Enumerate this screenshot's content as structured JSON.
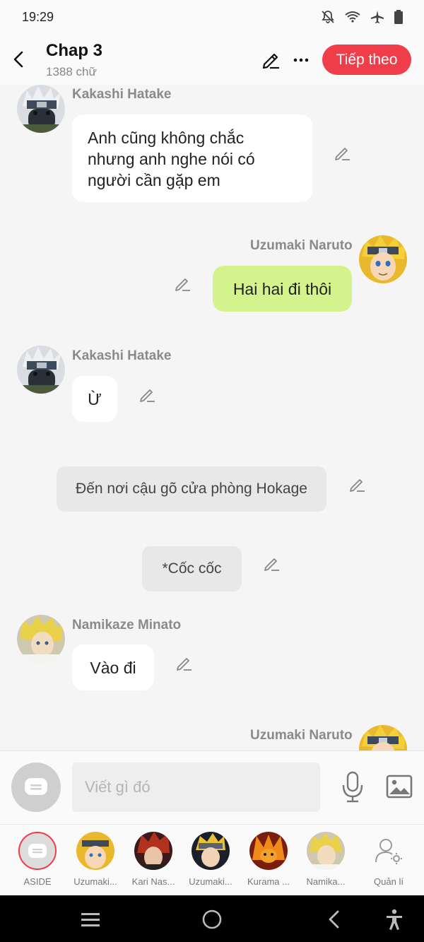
{
  "status": {
    "time": "19:29"
  },
  "header": {
    "title": "Chap 3",
    "subtitle": "1388 chữ",
    "next_label": "Tiếp theo"
  },
  "messages": [
    {
      "sender": "Kakashi Hatake",
      "text_lines": [
        "Anh cũng không chắc",
        "nhưng anh nghe nói có",
        "người cần gặp em"
      ]
    },
    {
      "sender": "Uzumaki Naruto",
      "text": "Hai hai đi thôi"
    },
    {
      "sender": "Kakashi Hatake",
      "text": "Ừ"
    },
    {
      "narration": "Đến nơi cậu gõ cửa phòng Hokage"
    },
    {
      "narration": "*Cốc cốc"
    },
    {
      "sender": "Namikaze Minato",
      "text": "Vào đi"
    },
    {
      "sender": "Uzumaki Naruto"
    }
  ],
  "composer": {
    "placeholder": "Viết gì đó"
  },
  "cast": [
    {
      "name": "ASIDE"
    },
    {
      "name": "Uzumaki..."
    },
    {
      "name": "Kari Nas..."
    },
    {
      "name": "Uzumaki..."
    },
    {
      "name": "Kurama ..."
    },
    {
      "name": "Namika..."
    },
    {
      "name": "Quản lí"
    }
  ],
  "colors": {
    "accent": "#ef3e4a",
    "my_bubble": "#d5f38d",
    "narration_bubble": "#e8e8e8",
    "background": "#f5f5f5"
  }
}
